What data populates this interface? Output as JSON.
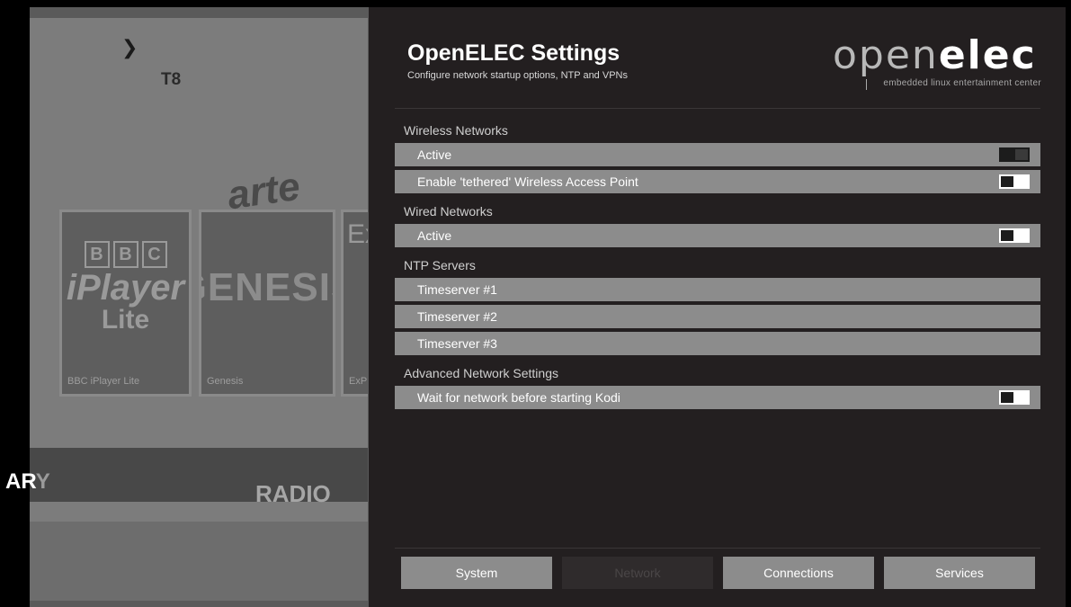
{
  "background": {
    "channel_label": "T8",
    "arte_label": "arte",
    "tiles": [
      {
        "label": "BBC iPlayer Lite",
        "art_lines": [
          "BBC",
          "iPlayer",
          "Lite"
        ]
      },
      {
        "label": "Genesis",
        "art_lines": [
          "GENESIS"
        ]
      },
      {
        "label": "ExP",
        "art_lines": [
          "Ex"
        ]
      }
    ],
    "nav": {
      "partial_item_bold": "AR",
      "partial_item_fade": "Y",
      "radio": "RADIO"
    }
  },
  "dialog": {
    "title": "OpenELEC Settings",
    "subtitle": "Configure network startup options, NTP and VPNs",
    "logo": {
      "text_light": "open",
      "text_bold": "elec",
      "tagline": "embedded linux entertainment center"
    },
    "sections": [
      {
        "heading": "Wireless Networks",
        "rows": [
          {
            "label": "Active",
            "toggle": "off"
          },
          {
            "label": "Enable 'tethered' Wireless Access Point",
            "toggle": "on"
          }
        ]
      },
      {
        "heading": "Wired Networks",
        "rows": [
          {
            "label": "Active",
            "toggle": "on"
          }
        ]
      },
      {
        "heading": "NTP Servers",
        "rows": [
          {
            "label": "Timeserver #1"
          },
          {
            "label": "Timeserver #2"
          },
          {
            "label": "Timeserver #3"
          }
        ]
      },
      {
        "heading": "Advanced Network Settings",
        "rows": [
          {
            "label": "Wait for network before starting Kodi",
            "toggle": "on"
          }
        ]
      }
    ],
    "buttons": [
      {
        "label": "System",
        "active": false
      },
      {
        "label": "Network",
        "active": true
      },
      {
        "label": "Connections",
        "active": false
      },
      {
        "label": "Services",
        "active": false
      }
    ]
  },
  "colors": {
    "dialog_bg": "#231f20",
    "row_bg": "#8c8c8c",
    "active_tab_bg": "#2f2b2c"
  }
}
